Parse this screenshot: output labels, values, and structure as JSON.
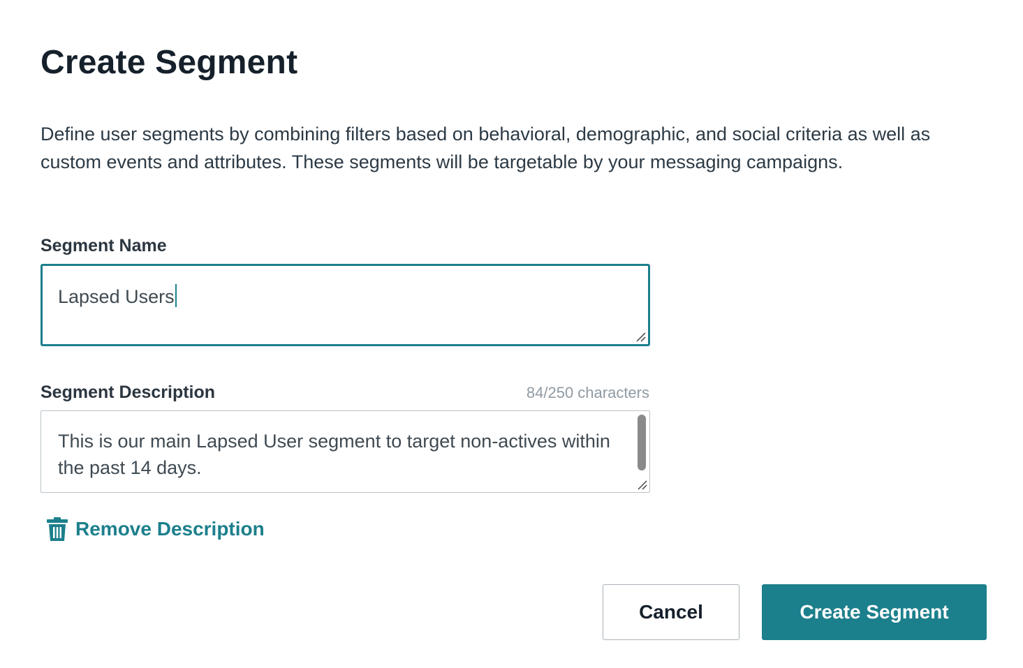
{
  "dialog": {
    "title": "Create Segment",
    "description": "Define user segments by combining filters based on behavioral, demographic, and social criteria as well as custom events and attributes. These segments will be targetable by your messaging campaigns."
  },
  "segment_name": {
    "label": "Segment Name",
    "value": "Lapsed Users"
  },
  "segment_description": {
    "label": "Segment Description",
    "char_count": "84/250 characters",
    "value": "This is our main Lapsed User segment to target non-actives within the past 14 days."
  },
  "remove_description": {
    "label": "Remove Description",
    "icon": "trash-icon"
  },
  "actions": {
    "cancel_label": "Cancel",
    "create_label": "Create Segment"
  },
  "colors": {
    "accent": "#1c7f8c",
    "title": "#15202b",
    "muted": "#8f9aa3",
    "border": "#b9c2c8"
  }
}
